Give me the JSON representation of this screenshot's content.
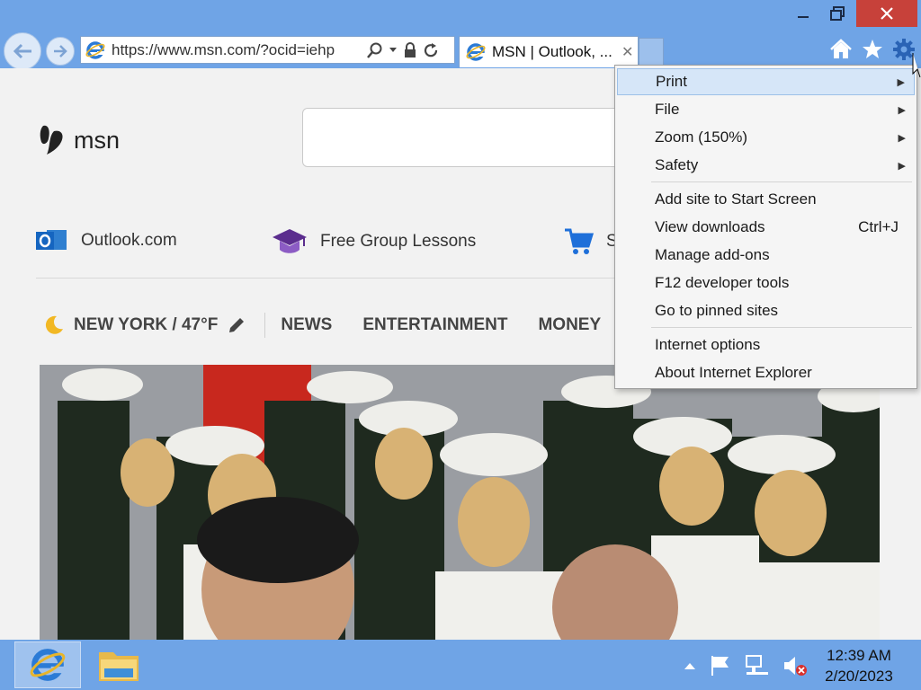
{
  "browser": {
    "address_url": "https://www.msn.com/?ocid=iehp",
    "tab_title": "MSN | Outlook, ...",
    "tab_close": "✕",
    "accent_color": "#6fa4e6",
    "icons": [
      "back-icon",
      "forward-icon",
      "ie-icon",
      "search-icon",
      "dropdown-icon",
      "lock-icon",
      "refresh-icon",
      "home-icon",
      "star-icon",
      "gear-icon"
    ]
  },
  "page": {
    "logo_text": "msn",
    "quick_links": [
      {
        "label": "Outlook.com",
        "icon": "outlook-icon"
      },
      {
        "label": "Free Group Lessons",
        "icon": "graduation-cap-icon"
      },
      {
        "label": "S",
        "icon": "shopping-cart-icon"
      }
    ],
    "weather": "NEW YORK / 47°F",
    "nav_links": [
      "NEWS",
      "ENTERTAINMENT",
      "MONEY"
    ]
  },
  "menu": {
    "items": [
      {
        "label": "Print",
        "submenu": true,
        "highlighted": true
      },
      {
        "label": "File",
        "submenu": true
      },
      {
        "label": "Zoom (150%)",
        "submenu": true
      },
      {
        "label": "Safety",
        "submenu": true
      },
      {
        "label": "Add site to Start Screen"
      },
      {
        "label": "View downloads",
        "shortcut": "Ctrl+J"
      },
      {
        "label": "Manage add-ons"
      },
      {
        "label": "F12 developer tools"
      },
      {
        "label": "Go to pinned sites"
      },
      {
        "label": "Internet options"
      },
      {
        "label": "About Internet Explorer"
      }
    ]
  },
  "taskbar": {
    "time": "12:39 AM",
    "date": "2/20/2023"
  }
}
